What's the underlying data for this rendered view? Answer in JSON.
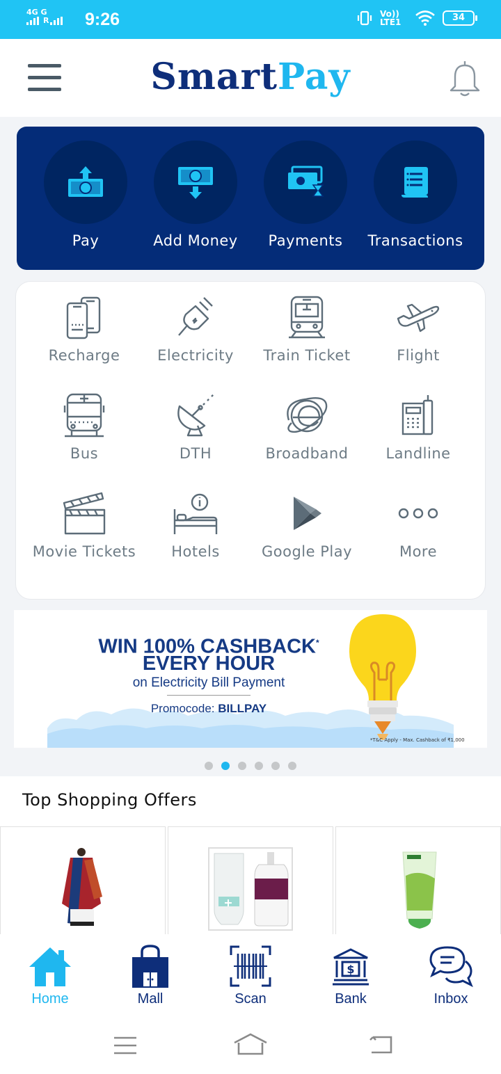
{
  "status_bar": {
    "network": "4G G",
    "network2": "R",
    "time": "9:26",
    "volte": "Vo)) LTE1",
    "battery": "34"
  },
  "header": {
    "logo_part1": "Smart",
    "logo_part2": "Pay"
  },
  "quick_actions": [
    {
      "label": "Pay",
      "icon": "pay-icon"
    },
    {
      "label": "Add Money",
      "icon": "add-money-icon"
    },
    {
      "label": "Payments",
      "icon": "payments-icon"
    },
    {
      "label": "Transactions",
      "icon": "transactions-icon"
    }
  ],
  "services": [
    {
      "label": "Recharge",
      "icon": "mobile-recharge-icon"
    },
    {
      "label": "Electricity",
      "icon": "electric-plug-icon"
    },
    {
      "label": "Train Ticket",
      "icon": "train-icon"
    },
    {
      "label": "Flight",
      "icon": "airplane-icon"
    },
    {
      "label": "Bus",
      "icon": "bus-icon"
    },
    {
      "label": "DTH",
      "icon": "satellite-dish-icon"
    },
    {
      "label": "Broadband",
      "icon": "internet-icon"
    },
    {
      "label": "Landline",
      "icon": "landline-phone-icon"
    },
    {
      "label": "Movie Tickets",
      "icon": "clapperboard-icon"
    },
    {
      "label": "Hotels",
      "icon": "hotel-bed-icon"
    },
    {
      "label": "Google Play",
      "icon": "google-play-icon"
    },
    {
      "label": "More",
      "icon": "more-dots-icon"
    }
  ],
  "banner": {
    "headline1": "WIN 100% CASHBACK",
    "headline1_mark": "*",
    "headline2": "EVERY HOUR",
    "subline": "on Electricity Bill Payment",
    "promo_label": "Promocode: ",
    "promo_code": "BILLPAY",
    "tc": "*T&C Apply - Max. Cashback of ₹1,000"
  },
  "carousel": {
    "count": 6,
    "active_index": 1
  },
  "offers": {
    "title": "Top Shopping Offers"
  },
  "bottom_nav": [
    {
      "label": "Home",
      "icon": "home-icon",
      "active": true
    },
    {
      "label": "Mall",
      "icon": "shopping-bag-icon",
      "active": false
    },
    {
      "label": "Scan",
      "icon": "barcode-scan-icon",
      "active": false
    },
    {
      "label": "Bank",
      "icon": "bank-icon",
      "active": false
    },
    {
      "label": "Inbox",
      "icon": "chat-bubbles-icon",
      "active": false
    }
  ],
  "colors": {
    "primary": "#042c78",
    "accent": "#1fb7ef",
    "status_bar": "#20c4f4",
    "service_icon": "#6d7b85"
  }
}
